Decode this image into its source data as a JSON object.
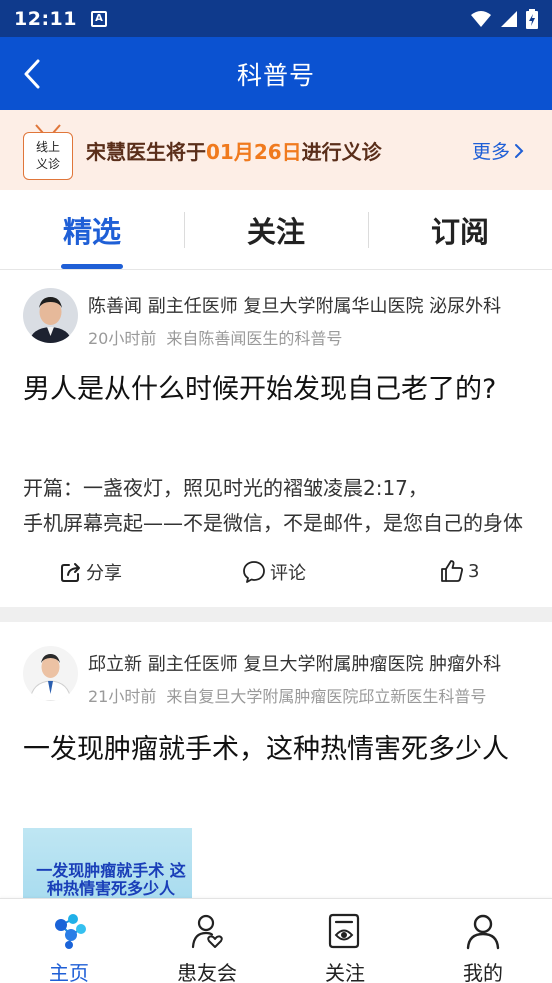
{
  "status_bar": {
    "time": "12:11",
    "notification": "A"
  },
  "nav": {
    "title": "科普号"
  },
  "banner": {
    "badge_line1": "线上",
    "badge_line2": "义诊",
    "text_before": "宋慧医生将于",
    "date": "01月26日",
    "text_after": "进行义诊",
    "more": "更多"
  },
  "tabs": [
    {
      "label": "精选",
      "active": true
    },
    {
      "label": "关注",
      "active": false
    },
    {
      "label": "订阅",
      "active": false
    }
  ],
  "posts": [
    {
      "author": "陈善闻 副主任医师 复旦大学附属华山医院 泌尿外科",
      "time": "20小时前",
      "source": "来自陈善闻医生的科普号",
      "title": "男人是从什么时候开始发现自己老了的?",
      "excerpt_line1": " 开篇：一盏夜灯，照见时光的褶皱凌晨2:17，",
      "excerpt_line2": "手机屏幕亮起——不是微信，不是邮件，是您自己的身体",
      "share": "分享",
      "comment": "评论",
      "likes": "3"
    },
    {
      "author": "邱立新 副主任医师 复旦大学附属肿瘤医院 肿瘤外科",
      "time": "21小时前",
      "source": "来自复旦大学附属肿瘤医院邱立新医生科普号",
      "title": "一发现肿瘤就手术，这种热情害死多少人",
      "thumb_text": "一发现肿瘤就手术 这种热情害死多少人"
    }
  ],
  "bottom_nav": [
    {
      "label": "主页",
      "icon": "home-icon",
      "active": true
    },
    {
      "label": "患友会",
      "icon": "patient-community-icon",
      "active": false
    },
    {
      "label": "关注",
      "icon": "follow-icon",
      "active": false
    },
    {
      "label": "我的",
      "icon": "profile-icon",
      "active": false
    }
  ],
  "colors": {
    "nav_blue": "#0b52d1",
    "status_blue": "#0f3a8c",
    "accent": "#1f5fd6",
    "date_orange": "#f07a1e"
  }
}
